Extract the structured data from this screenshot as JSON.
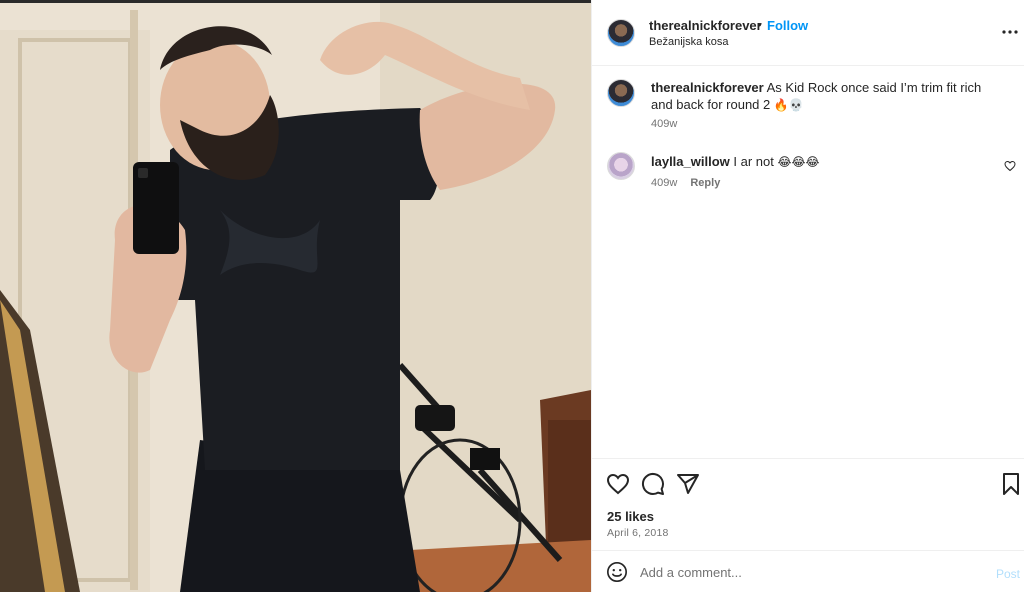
{
  "post": {
    "username": "therealnickforever",
    "separator": "•",
    "follow_label": "Follow",
    "location": "Bežanijska kosa",
    "more_icon": "more-horizontal-icon",
    "photo_description_icon": "photo"
  },
  "comments": [
    {
      "username": "therealnickforever",
      "text": "As Kid Rock once said I’m trim fit rich and back for round 2",
      "emoji": "🔥💀",
      "age": "409w",
      "reply_label": ""
    },
    {
      "username": "laylla_willow",
      "text": "I ar not",
      "emoji": "😂😂😂",
      "age": "409w",
      "reply_label": "Reply"
    }
  ],
  "actions": {
    "likes": "25 likes",
    "date": "April 6, 2018"
  },
  "composer": {
    "placeholder": "Add a comment...",
    "post_label": "Post"
  },
  "colors": {
    "accent": "#0095f6",
    "post_disabled": "#b2dffc",
    "secondary_text": "#737373"
  }
}
